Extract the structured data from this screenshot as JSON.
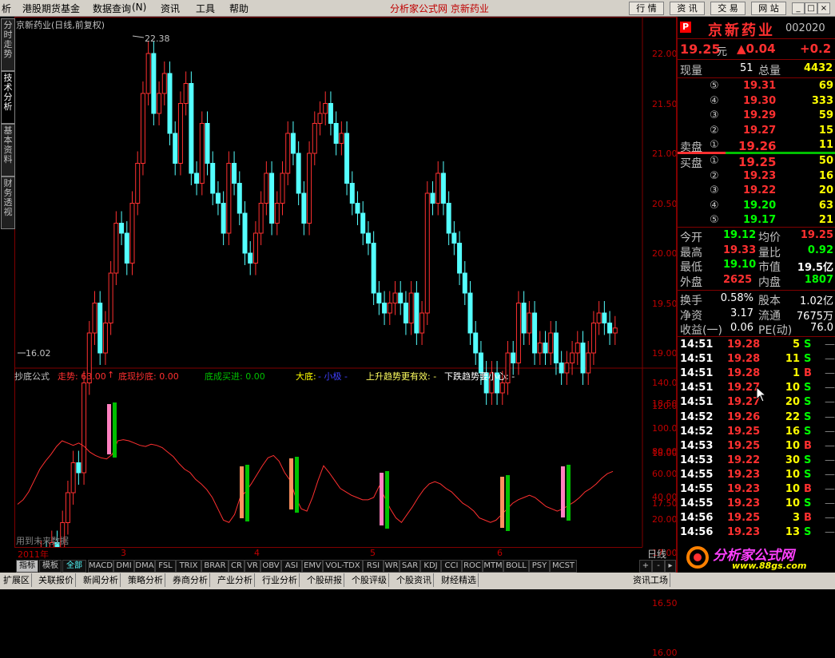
{
  "menu": {
    "items": [
      "析",
      "港股期货基金",
      "数据查询",
      "(N)",
      "资讯",
      "工具",
      "帮助"
    ],
    "center_title": "分析家公式网  京新药业",
    "right_buttons": [
      "行 情",
      "资 讯",
      "交 易",
      "网 站"
    ],
    "window_buttons": [
      "_",
      "□",
      "×"
    ]
  },
  "left_tabs": [
    "分时走势",
    "技术分析",
    "基本资料",
    "财务透视"
  ],
  "main_chart": {
    "title": "京新药业(日线,前复权)",
    "high_marker": "22.38",
    "low_marker": "16.02",
    "y_labels": [
      "22.00",
      "21.50",
      "21.00",
      "20.50",
      "20.00",
      "19.50",
      "19.00",
      "18.50",
      "18.00",
      "17.50",
      "17.00",
      "16.50",
      "16.00"
    ]
  },
  "indicator": {
    "name": "抄底公式",
    "fields": [
      {
        "label": "走势: 63.00",
        "color": "#ff3030"
      },
      {
        "label": "↑",
        "color": "#ff3030"
      },
      {
        "label": "底现抄底: 0.00",
        "color": "#ff3030"
      },
      {
        "label": "底成买进: 0.00",
        "color": "#00c000"
      },
      {
        "label": "大底:",
        "color": "#ffff00"
      },
      {
        "label": "- 小极 -",
        "color": "#4040ff"
      },
      {
        "label": "上升趋势更有效: -",
        "color": "#ffff60"
      },
      {
        "label": "下跌趋势要小心: -",
        "color": "#ffffff"
      }
    ],
    "y_labels": [
      "140.00",
      "120.00",
      "100.00",
      "80.00",
      "60.00",
      "40.00",
      "20.00"
    ],
    "footer_text": "用到未来数据"
  },
  "date_bar": {
    "labels": [
      "2011年",
      "3",
      "4",
      "5",
      "6"
    ],
    "right_label": "日线"
  },
  "indicator_tabs": [
    "指标",
    "模板",
    "全部",
    "MACD",
    "DMI",
    "DMA",
    "FSL",
    "TRIX",
    "BRAR",
    "CR",
    "VR",
    "OBV",
    "ASI",
    "EMV",
    "VOL-TDX",
    "RSI",
    "WR",
    "SAR",
    "KDJ",
    "CCI",
    "ROC",
    "MTM",
    "BOLL",
    "PSY",
    "MCST"
  ],
  "status_tabs": [
    "扩展区",
    "关联报价",
    "新闻分析",
    "策略分析",
    "券商分析",
    "产业分析",
    "行业分析",
    "个股研报",
    "个股评级",
    "个股资讯",
    "财经精选",
    "资讯工场"
  ],
  "quote": {
    "name": "京新药业",
    "code": "002020",
    "price": "19.25",
    "unit": "元",
    "change": "▲0.04",
    "change_pct": "+0.2",
    "current_vol_label": "现量",
    "current_vol": "51",
    "total_vol_label": "总量",
    "total_vol": "4432",
    "sell_levels": [
      {
        "idx": "⑤",
        "price": "19.31",
        "vol": "69"
      },
      {
        "idx": "④",
        "price": "19.30",
        "vol": "333"
      },
      {
        "idx": "③",
        "price": "19.29",
        "vol": "59"
      },
      {
        "idx": "②",
        "price": "19.27",
        "vol": "15"
      },
      {
        "idx": "①",
        "price": "19.26",
        "vol": "11",
        "label": "卖盘"
      }
    ],
    "buy_levels": [
      {
        "idx": "①",
        "price": "19.25",
        "vol": "50",
        "label": "买盘"
      },
      {
        "idx": "②",
        "price": "19.23",
        "vol": "16"
      },
      {
        "idx": "③",
        "price": "19.22",
        "vol": "20"
      },
      {
        "idx": "④",
        "price": "19.20",
        "vol": "63"
      },
      {
        "idx": "⑤",
        "price": "19.17",
        "vol": "21"
      }
    ],
    "stats": [
      {
        "l1": "今开",
        "v1": "19.12",
        "c1": "#00ff00",
        "l2": "均价",
        "v2": "19.25",
        "c2": "#ff3030"
      },
      {
        "l1": "最高",
        "v1": "19.33",
        "c1": "#ff3030",
        "l2": "量比",
        "v2": "0.92",
        "c2": "#00ff00"
      },
      {
        "l1": "最低",
        "v1": "19.10",
        "c1": "#00ff00",
        "l2": "市值",
        "v2": "19.5亿",
        "c2": "#ffffff"
      },
      {
        "l1": "外盘",
        "v1": "2625",
        "c1": "#ff3030",
        "l2": "内盘",
        "v2": "1807",
        "c2": "#00ff00"
      }
    ],
    "stats2": [
      {
        "l1": "换手",
        "v1": "0.58%",
        "l2": "股本",
        "v2": "1.02亿"
      },
      {
        "l1": "净资",
        "v1": "3.17",
        "l2": "流通",
        "v2": "7675万"
      },
      {
        "l1": "收益(一)",
        "v1": "0.06",
        "l2": "PE(动)",
        "v2": "76.0"
      }
    ],
    "ticks": [
      {
        "t": "14:51",
        "p": "19.28",
        "v": "5",
        "d": "S"
      },
      {
        "t": "14:51",
        "p": "19.28",
        "v": "11",
        "d": "S"
      },
      {
        "t": "14:51",
        "p": "19.28",
        "v": "1",
        "d": "B"
      },
      {
        "t": "14:51",
        "p": "19.27",
        "v": "10",
        "d": "S"
      },
      {
        "t": "14:51",
        "p": "19.27",
        "v": "20",
        "d": "S"
      },
      {
        "t": "14:52",
        "p": "19.26",
        "v": "22",
        "d": "S"
      },
      {
        "t": "14:52",
        "p": "19.25",
        "v": "16",
        "d": "S"
      },
      {
        "t": "14:53",
        "p": "19.25",
        "v": "10",
        "d": "B"
      },
      {
        "t": "14:53",
        "p": "19.22",
        "v": "30",
        "d": "S"
      },
      {
        "t": "14:55",
        "p": "19.23",
        "v": "10",
        "d": "S"
      },
      {
        "t": "14:55",
        "p": "19.23",
        "v": "10",
        "d": "B"
      },
      {
        "t": "14:55",
        "p": "19.23",
        "v": "10",
        "d": "S"
      },
      {
        "t": "14:56",
        "p": "19.25",
        "v": "3",
        "d": "B"
      },
      {
        "t": "14:56",
        "p": "19.23",
        "v": "13",
        "d": "S"
      }
    ],
    "watermark": "分析家公式网",
    "watermark_url": "www.88gs.com"
  },
  "colors": {
    "up": "#ff3030",
    "down": "#54ffff",
    "frame": "#800000",
    "axis": "#c00000",
    "line": "#ff3030"
  }
}
